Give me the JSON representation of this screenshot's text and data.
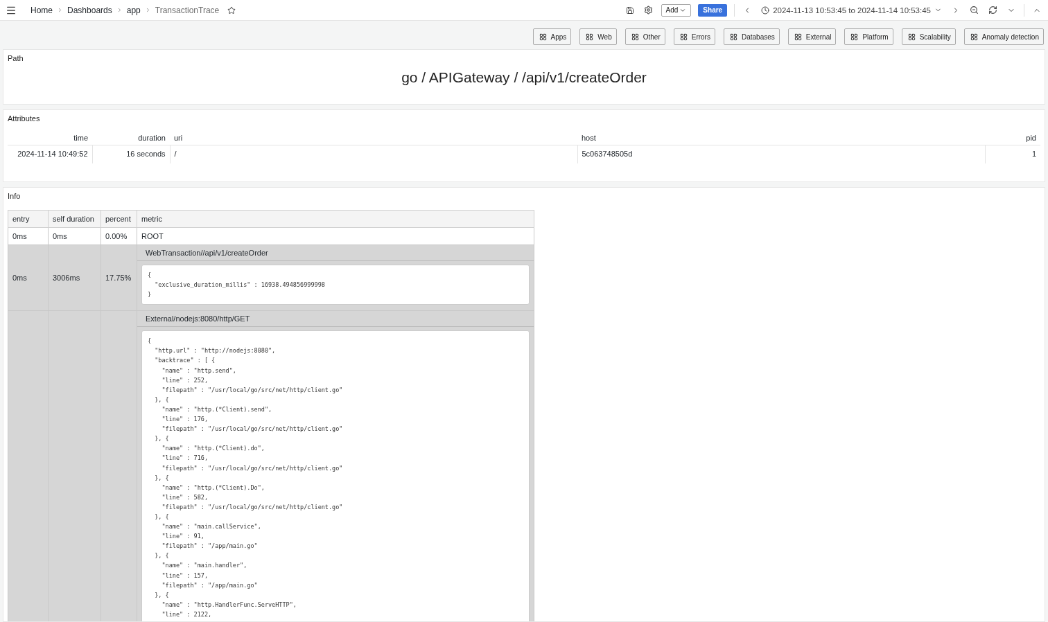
{
  "breadcrumbs": [
    {
      "label": "Home",
      "current": false
    },
    {
      "label": "Dashboards",
      "current": false
    },
    {
      "label": "app",
      "current": false
    },
    {
      "label": "TransactionTrace",
      "current": true
    }
  ],
  "topbar": {
    "add": "Add",
    "share": "Share",
    "time_range": "2024-11-13 10:53:45 to 2024-11-14 10:53:45"
  },
  "links": [
    "Apps",
    "Web",
    "Other",
    "Errors",
    "Databases",
    "External",
    "Platform",
    "Scalability",
    "Anomaly detection"
  ],
  "path_panel": {
    "title": "Path",
    "path": "go / APIGateway / /api/v1/createOrder"
  },
  "attributes_panel": {
    "title": "Attributes",
    "columns": [
      "time",
      "duration",
      "uri",
      "host",
      "pid"
    ],
    "rows": [
      [
        "2024-11-14 10:49:52",
        "16 seconds",
        "/",
        "5c063748505d",
        "1"
      ]
    ]
  },
  "info_panel": {
    "title": "Info",
    "columns": [
      "entry",
      "self duration",
      "percent",
      "metric"
    ],
    "rows": [
      {
        "kind": "plain",
        "entry": "0ms",
        "self_duration": "0ms",
        "percent": "0.00%",
        "metric": "ROOT"
      },
      {
        "kind": "detail",
        "entry": "0ms",
        "self_duration": "3006ms",
        "percent": "17.75%",
        "metric": "WebTransaction//api/v1/createOrder",
        "code": "{\n  \"exclusive_duration_millis\" : 16938.494856999998\n}"
      },
      {
        "kind": "detail",
        "metric": "External/nodejs:8080/http/GET",
        "code": "{\n  \"http.url\" : \"http://nodejs:8080\",\n  \"backtrace\" : [ {\n    \"name\" : \"http.send\",\n    \"line\" : 252,\n    \"filepath\" : \"/usr/local/go/src/net/http/client.go\"\n  }, {\n    \"name\" : \"http.(*Client).send\",\n    \"line\" : 176,\n    \"filepath\" : \"/usr/local/go/src/net/http/client.go\"\n  }, {\n    \"name\" : \"http.(*Client).do\",\n    \"line\" : 716,\n    \"filepath\" : \"/usr/local/go/src/net/http/client.go\"\n  }, {\n    \"name\" : \"http.(*Client).Do\",\n    \"line\" : 582,\n    \"filepath\" : \"/usr/local/go/src/net/http/client.go\"\n  }, {\n    \"name\" : \"main.callService\",\n    \"line\" : 91,\n    \"filepath\" : \"/app/main.go\"\n  }, {\n    \"name\" : \"main.handler\",\n    \"line\" : 157,\n    \"filepath\" : \"/app/main.go\"\n  }, {\n    \"name\" : \"http.HandlerFunc.ServeHTTP\",\n    \"line\" : 2122,"
      }
    ]
  }
}
